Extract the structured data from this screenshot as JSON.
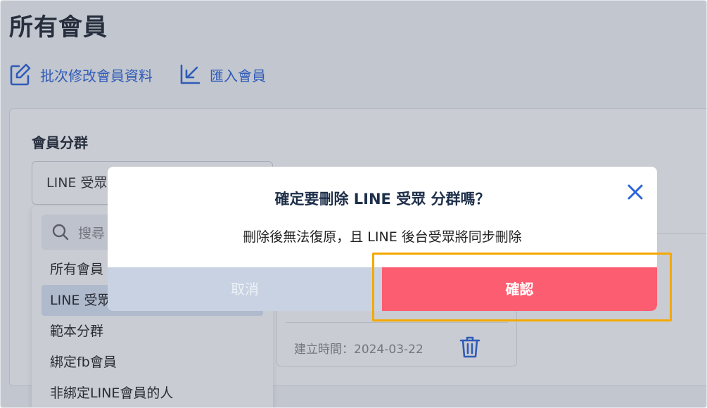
{
  "page": {
    "title": "所有會員"
  },
  "actions": {
    "batch_edit_label": "批次修改會員資料",
    "import_label": "匯入會員"
  },
  "segment": {
    "label": "會員分群",
    "selected_value": "LINE 受眾",
    "search_placeholder": "搜尋",
    "options": [
      "所有會員",
      "LINE 受眾",
      "範本分群",
      "綁定fb會員",
      "非綁定LINE會員的人"
    ]
  },
  "card": {
    "created_label": "建立時間：2024-03-22"
  },
  "modal": {
    "title": "確定要刪除 LINE 受眾 分群嗎？",
    "message": "刪除後無法復原，且 LINE 後台受眾將同步刪除",
    "cancel_label": "取消",
    "confirm_label": "確認"
  },
  "colors": {
    "accent": "#2b63d9",
    "confirm": "#fd5d71",
    "cancel": "#c8d2e2",
    "highlight": "#f5a800"
  }
}
